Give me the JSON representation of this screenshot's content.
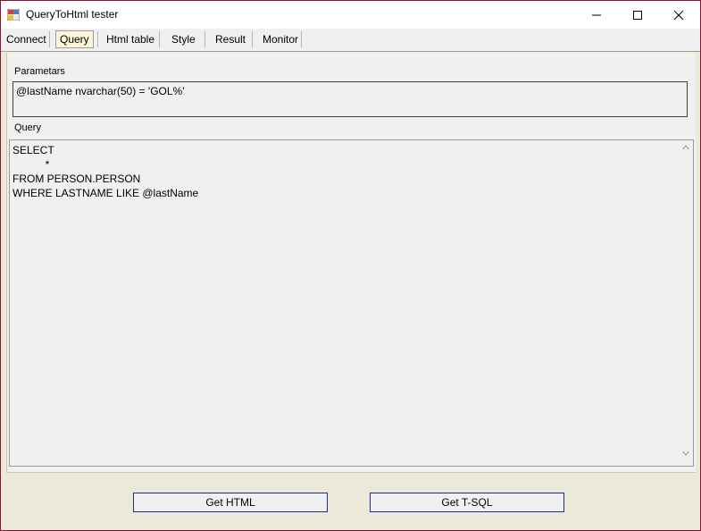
{
  "window": {
    "title": "QueryToHtml tester"
  },
  "toolbar": {
    "tabs": [
      {
        "label": "Connect"
      },
      {
        "label": "Query"
      },
      {
        "label": "Html table"
      },
      {
        "label": "Style"
      },
      {
        "label": "Result"
      },
      {
        "label": "Monitor"
      }
    ],
    "active_tab": "Query"
  },
  "params": {
    "label": "Parametars",
    "value": "@lastName nvarchar(50) = 'GOL%'"
  },
  "query": {
    "label": "Query",
    "text": "SELECT\n           *\nFROM PERSON.PERSON\nWHERE LASTNAME LIKE @lastName"
  },
  "buttons": {
    "get_html": "Get HTML",
    "get_tsql": "Get T-SQL"
  },
  "colors": {
    "frame_border": "#8a1538",
    "panel_bg": "#f0f0f0",
    "window_bg": "#ece9d8",
    "active_tab_bg": "#fcf5d6",
    "button_border": "#1c2b8a"
  }
}
